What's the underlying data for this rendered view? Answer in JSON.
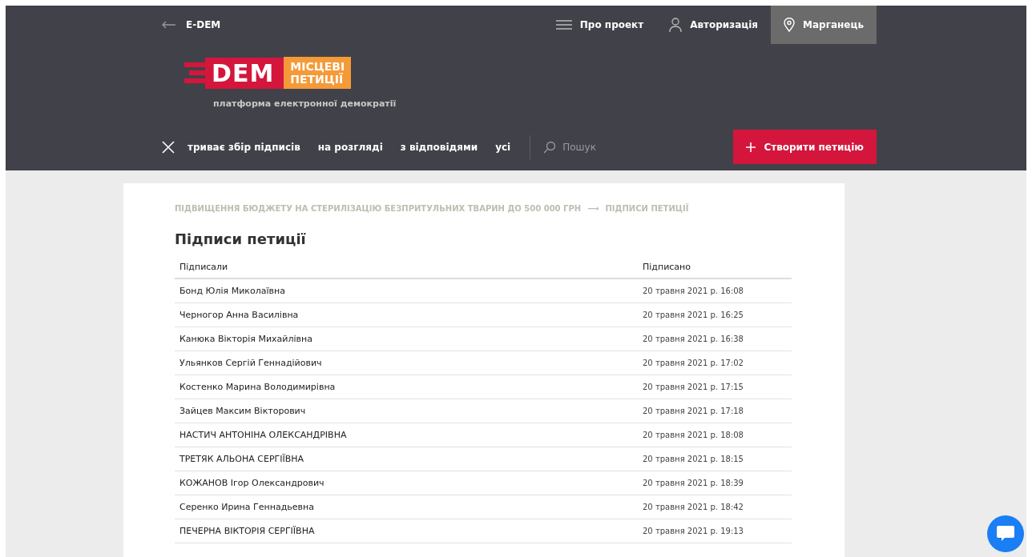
{
  "topbar": {
    "back_label": "E-DEM",
    "links": [
      {
        "kind": "menu",
        "label": "Про проект"
      },
      {
        "kind": "user",
        "label": "Авторизація"
      },
      {
        "kind": "location",
        "label": "Марганець"
      }
    ]
  },
  "logo": {
    "mark": "DEM",
    "badge_line_1": "МІСЦЕВІ",
    "badge_line_2": "ПЕТИЦІЇ",
    "tagline": "платформа електронної демократії"
  },
  "filters": [
    "триває збір підписів",
    "на розгляді",
    "з відповідями",
    "усі"
  ],
  "search": {
    "placeholder": "Пошук"
  },
  "create_button": "Створити петицію",
  "breadcrumb": [
    "ПІДВИЩЕННЯ БЮДЖЕТУ НА СТЕРИЛІЗАЦІЮ БЕЗПРИТУЛЬНИХ ТВАРИН ДО 500 000 ГРН",
    "ПІДПИСИ ПЕТИЦІЇ"
  ],
  "breadcrumb_separator": "⟶",
  "title": "Підписи петиції",
  "table": {
    "columns": [
      "Підписали",
      "Підписано"
    ],
    "rows": [
      [
        "Бонд Юлія Миколаївна",
        "20 травня 2021 р. 16:08"
      ],
      [
        "Черногор Анна Василівна",
        "20 травня 2021 р. 16:25"
      ],
      [
        "Канюка Вікторія Михайлівна",
        "20 травня 2021 р. 16:38"
      ],
      [
        "Ульянков Сергій Геннадійович",
        "20 травня 2021 р. 17:02"
      ],
      [
        "Костенко Марина Володимирівна",
        "20 травня 2021 р. 17:15"
      ],
      [
        "Зайцев Максим Вікторович",
        "20 травня 2021 р. 17:18"
      ],
      [
        "НАСТИЧ АНТОНІНА ОЛЕКСАНДРІВНА",
        "20 травня 2021 р. 18:08"
      ],
      [
        "ТРЕТЯК АЛЬОНА СЕРГІЇВНА",
        "20 травня 2021 р. 18:15"
      ],
      [
        "КОЖАНОВ Ігор Олександрович",
        "20 травня 2021 р. 18:39"
      ],
      [
        "Серенко Ирина Геннадьевна",
        "20 травня 2021 р. 18:42"
      ],
      [
        "ПЕЧЕРНА ВІКТОРІЯ СЕРГІЇВНА",
        "20 травня 2021 р. 19:13"
      ]
    ]
  }
}
